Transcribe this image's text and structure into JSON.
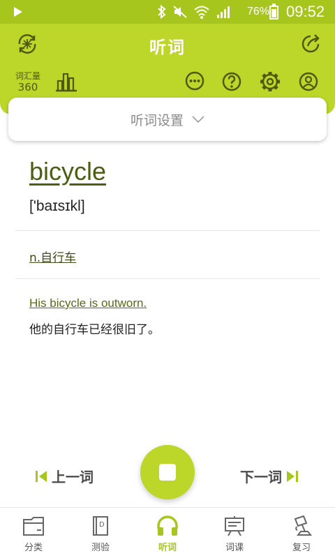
{
  "status_bar": {
    "battery": "76%",
    "time": "09:52"
  },
  "header": {
    "title": "听词",
    "vocab_label": "词汇量",
    "vocab_count": "360"
  },
  "settings": {
    "label": "听词设置"
  },
  "word": {
    "text": "bicycle",
    "phonetic": "['baɪsɪkl]",
    "meaning": "n.自行车",
    "example_en": "His bicycle is outworn.",
    "example_zh": "他的自行车已经很旧了。"
  },
  "controls": {
    "prev_label": "上一词",
    "next_label": "下一词"
  },
  "bottom_nav": [
    {
      "label": "分类",
      "icon": "folder-icon",
      "active": false
    },
    {
      "label": "测验",
      "icon": "quiz-book-icon",
      "active": false
    },
    {
      "label": "听词",
      "icon": "headphones-icon",
      "active": true
    },
    {
      "label": "词课",
      "icon": "lesson-board-icon",
      "active": false
    },
    {
      "label": "复习",
      "icon": "lamp-icon",
      "active": false
    }
  ],
  "colors": {
    "accent": "#bcd72a",
    "status_bar": "#a6c61d",
    "word": "#4a5f12"
  }
}
